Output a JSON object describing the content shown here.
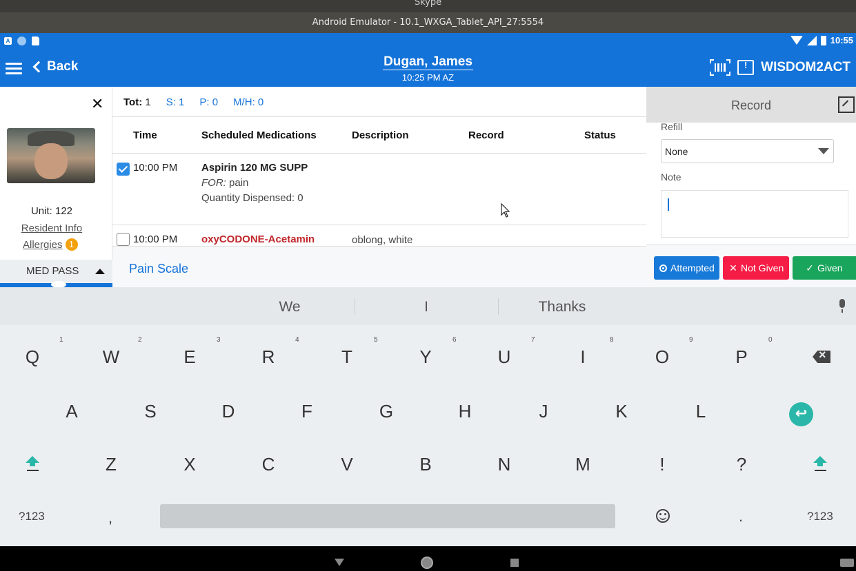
{
  "window": {
    "os_title": "Skype",
    "emulator_title": "Android Emulator - 10.1_WXGA_Tablet_API_27:5554"
  },
  "status_bar": {
    "time": "10:55",
    "left_icon_a": "A"
  },
  "app_bar": {
    "back_label": "Back",
    "patient_name": "Dugan, James",
    "patient_time": "10:25 PM AZ",
    "brand": "WISDOM2ACT"
  },
  "resident": {
    "unit": "Unit: 122",
    "resident_info_link": "Resident Info",
    "allergies_label": "Allergies",
    "allergies_count": "1",
    "med_pass_label": "MED PASS"
  },
  "totals": {
    "tot_label": "Tot:",
    "tot_value": "1",
    "s": "S: 1",
    "p": "P: 0",
    "mh": "M/H: 0"
  },
  "table": {
    "headers": [
      "Time",
      "Scheduled Medications",
      "Description",
      "Record",
      "Status"
    ],
    "rows": [
      {
        "checked": true,
        "time": "10:00 PM",
        "medication": "Aspirin 120 MG SUPP",
        "for_label": "FOR:",
        "for_value": "pain",
        "quantity": "Quantity Dispensed: 0",
        "description": ""
      },
      {
        "checked": false,
        "time": "10:00 PM",
        "medication": "oxyCODONE-Acetamin",
        "description": "oblong, white"
      }
    ]
  },
  "pain_scale_link": "Pain Scale",
  "record_panel": {
    "title": "Record",
    "refill_label": "Refill",
    "refill_value": "None",
    "note_label": "Note",
    "note_value": "",
    "buttons": {
      "attempted": "Attempted",
      "not_given": "Not Given",
      "given": "Given"
    }
  },
  "keyboard": {
    "suggestions": [
      "We",
      "I",
      "Thanks"
    ],
    "row1": [
      "Q",
      "W",
      "E",
      "R",
      "T",
      "Y",
      "U",
      "I",
      "O",
      "P"
    ],
    "row1_numbers": [
      "1",
      "2",
      "3",
      "4",
      "5",
      "6",
      "7",
      "8",
      "9",
      "0"
    ],
    "row2": [
      "A",
      "S",
      "D",
      "F",
      "G",
      "H",
      "J",
      "K",
      "L"
    ],
    "row3": [
      "Z",
      "X",
      "C",
      "V",
      "B",
      "N",
      "M",
      "!",
      "?"
    ],
    "symbols_left": "?123",
    "comma": ",",
    "period": ".",
    "symbols_right": "?123",
    "enter_glyph": "↩"
  },
  "colors": {
    "primary": "#1473d9",
    "not_given": "#f51d45",
    "given": "#19a55b",
    "allergy_badge": "#f4a10d",
    "med_alert_red": "#c0262b",
    "keyboard_accent": "#2ab7a9"
  }
}
